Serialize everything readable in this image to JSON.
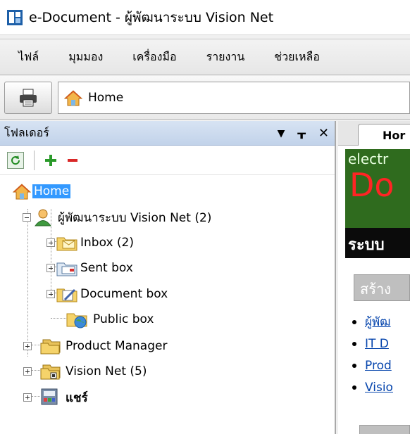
{
  "window": {
    "title": "e-Document - ผู้พัฒนาระบบ Vision Net"
  },
  "menu": [
    "ไฟล์",
    "มุมมอง",
    "เครื่องมือ",
    "รายงาน",
    "ช่วยเหลือ"
  ],
  "toolbar": {
    "address": "Home"
  },
  "folders_panel": {
    "title": "โฟลเดอร์",
    "controls": {
      "dropdown": "▼",
      "pin": "ᚁ",
      "close": "✕"
    }
  },
  "tree": {
    "root": "Home",
    "user": "ผู้พัฒนาระบบ Vision Net (2)",
    "inbox": "Inbox (2)",
    "sent": "Sent box",
    "document": "Document box",
    "public": "Public box",
    "product_manager": "Product Manager",
    "vision_net": "Vision Net (5)",
    "share": "แชร์"
  },
  "right": {
    "tab": "Hor",
    "banner": {
      "line1": "electr",
      "line2": "Do",
      "line3": "ระบบ"
    },
    "section": "สร้าง",
    "links": [
      "ผู้พัฒ",
      "IT D",
      "Prod",
      "Visio"
    ]
  }
}
